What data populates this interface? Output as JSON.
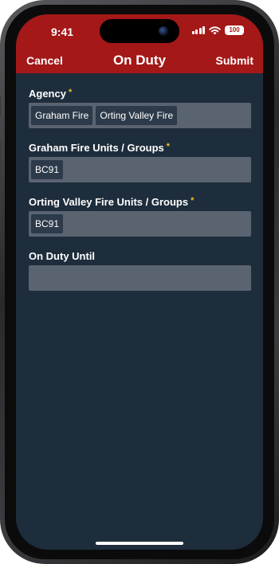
{
  "status_bar": {
    "time": "9:41",
    "battery": "100"
  },
  "nav": {
    "cancel_label": "Cancel",
    "title": "On Duty",
    "submit_label": "Submit"
  },
  "form": {
    "required_mark": "*",
    "agency": {
      "label": "Agency",
      "chips": [
        "Graham Fire",
        "Orting Valley Fire"
      ]
    },
    "graham_units": {
      "label": "Graham Fire Units / Groups",
      "chips": [
        "BC91"
      ]
    },
    "orting_units": {
      "label": "Orting Valley Fire Units / Groups",
      "chips": [
        "BC91"
      ]
    },
    "on_duty_until": {
      "label": "On Duty Until",
      "value": ""
    }
  },
  "colors": {
    "header": "#a41818",
    "background": "#1e2d3c",
    "field": "#5a6470",
    "chip": "#2c3a49",
    "required": "#f0c020"
  }
}
